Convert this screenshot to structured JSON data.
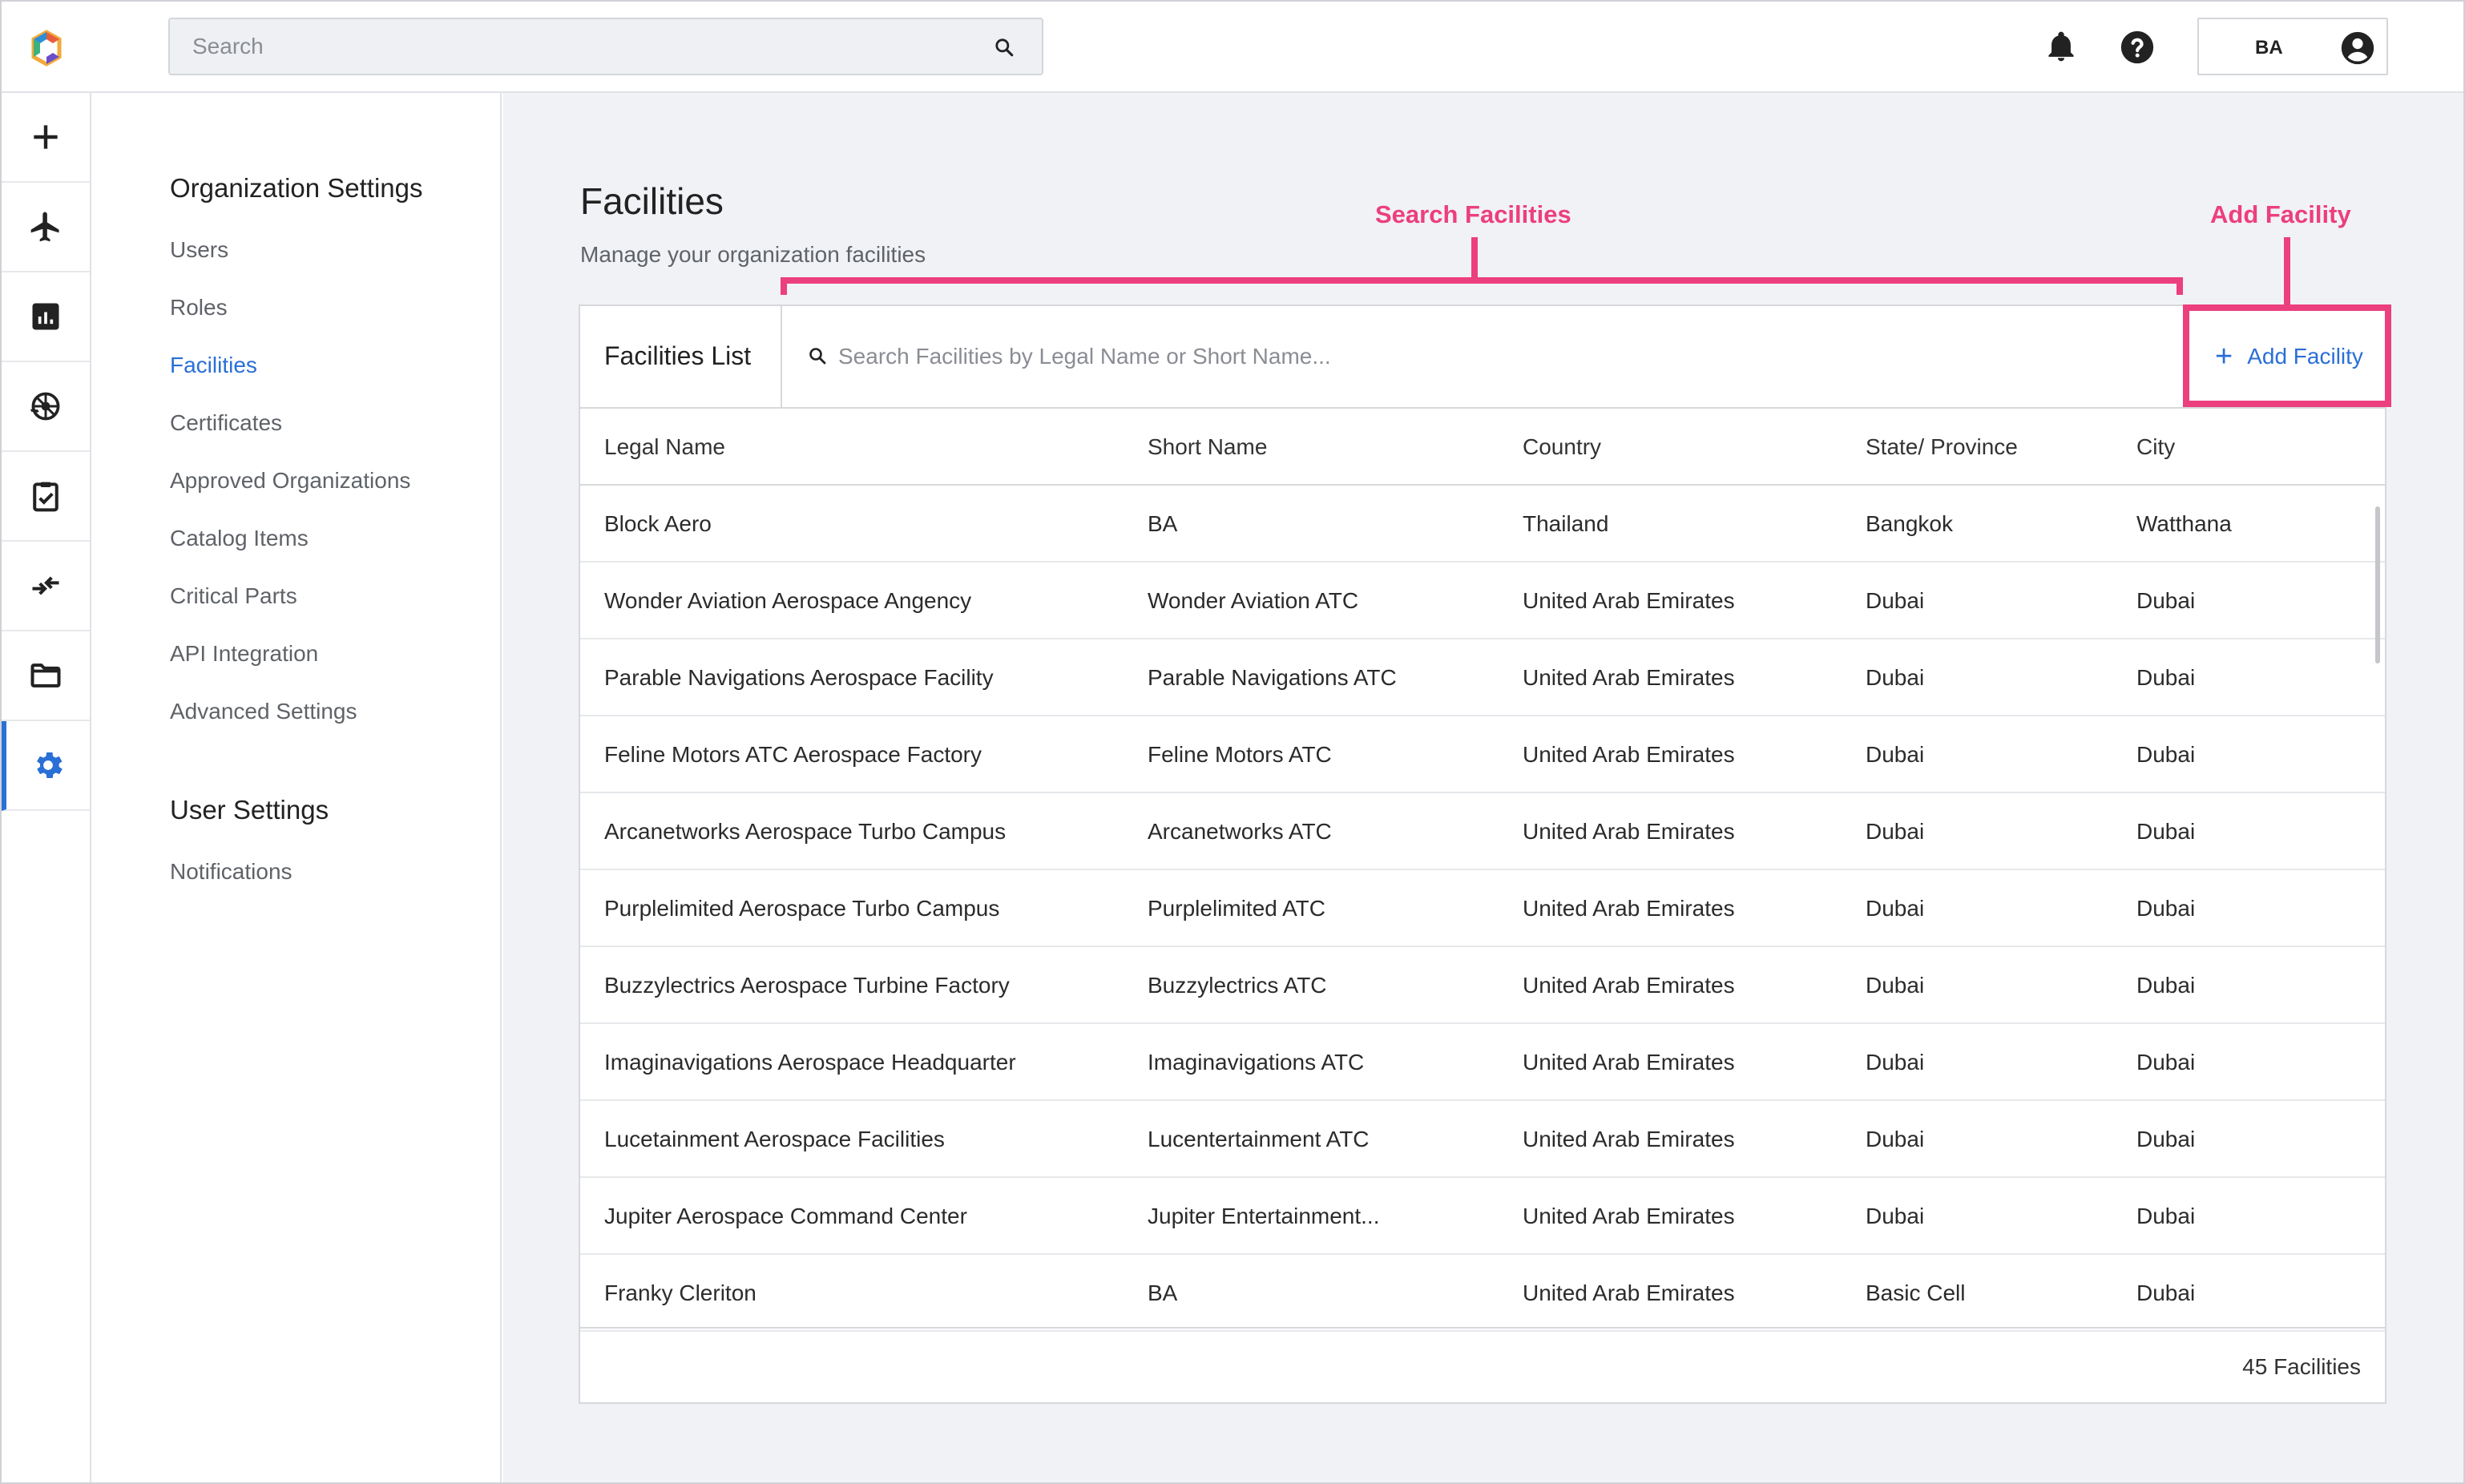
{
  "topbar": {
    "search_placeholder": "Search",
    "user_initials": "BA"
  },
  "rail": {
    "items": [
      {
        "icon": "plus-icon"
      },
      {
        "icon": "airplane-icon"
      },
      {
        "icon": "bar-chart-icon"
      },
      {
        "icon": "engine-icon"
      },
      {
        "icon": "clipboard-check-icon"
      },
      {
        "icon": "swap-icon"
      },
      {
        "icon": "folder-icon"
      },
      {
        "icon": "gear-icon",
        "active": true
      }
    ]
  },
  "settings_nav": {
    "org_heading": "Organization Settings",
    "org_items": [
      "Users",
      "Roles",
      "Facilities",
      "Certificates",
      "Approved Organizations",
      "Catalog Items",
      "Critical Parts",
      "API Integration",
      "Advanced Settings"
    ],
    "active_item": "Facilities",
    "user_heading": "User Settings",
    "user_items": [
      "Notifications"
    ]
  },
  "page": {
    "title": "Facilities",
    "subtitle": "Manage your organization facilities"
  },
  "card": {
    "title": "Facilities List",
    "search_placeholder": "Search Facilities by Legal Name or Short Name...",
    "add_label": "Add Facility",
    "columns": [
      "Legal Name",
      "Short Name",
      "Country",
      "State/ Province",
      "City"
    ],
    "rows": [
      [
        "Block Aero",
        "BA",
        "Thailand",
        "Bangkok",
        "Watthana"
      ],
      [
        "Wonder Aviation Aerospace Angency",
        "Wonder Aviation ATC",
        "United Arab Emirates",
        "Dubai",
        "Dubai"
      ],
      [
        "Parable Navigations Aerospace Facility",
        "Parable Navigations ATC",
        "United Arab Emirates",
        "Dubai",
        "Dubai"
      ],
      [
        "Feline Motors ATC Aerospace Factory",
        "Feline Motors ATC",
        "United Arab Emirates",
        "Dubai",
        "Dubai"
      ],
      [
        "Arcanetworks Aerospace Turbo Campus",
        "Arcanetworks ATC",
        "United Arab Emirates",
        "Dubai",
        "Dubai"
      ],
      [
        "Purplelimited Aerospace Turbo Campus",
        "Purplelimited ATC",
        "United Arab Emirates",
        "Dubai",
        "Dubai"
      ],
      [
        "Buzzylectrics Aerospace Turbine Factory",
        "Buzzylectrics ATC",
        "United Arab Emirates",
        "Dubai",
        "Dubai"
      ],
      [
        "Imaginavigations Aerospace Headquarter",
        "Imaginavigations ATC",
        "United Arab Emirates",
        "Dubai",
        "Dubai"
      ],
      [
        "Lucetainment Aerospace Facilities",
        "Lucentertainment ATC",
        "United Arab Emirates",
        "Dubai",
        "Dubai"
      ],
      [
        "Jupiter Aerospace Command Center",
        "Jupiter Entertainment...",
        "United Arab Emirates",
        "Dubai",
        "Dubai"
      ],
      [
        "Franky Cleriton",
        "BA",
        "United Arab Emirates",
        "Basic Cell",
        "Dubai"
      ]
    ],
    "footer_count": "45 Facilities"
  },
  "annotations": {
    "search_label": "Search Facilities",
    "add_label": "Add Facility",
    "color": "#ec3f7d"
  },
  "colors": {
    "accent": "#2a6fd6",
    "annotation": "#ec3f7d"
  }
}
